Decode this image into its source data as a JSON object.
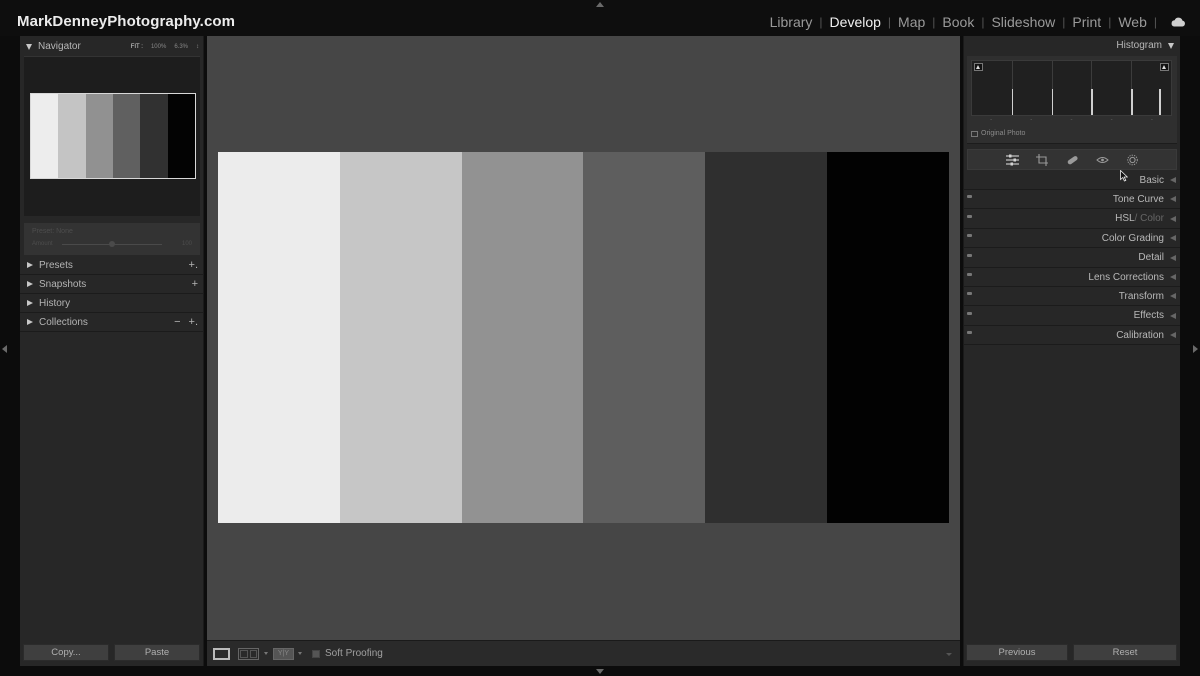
{
  "brand": "MarkDenneyPhotography.com",
  "modules": [
    {
      "label": "Library"
    },
    {
      "label": "Develop",
      "active": true
    },
    {
      "label": "Map"
    },
    {
      "label": "Book"
    },
    {
      "label": "Slideshow"
    },
    {
      "label": "Print"
    },
    {
      "label": "Web"
    }
  ],
  "navigator": {
    "title": "Navigator",
    "zoom": [
      "FIT :",
      "100%",
      "6.3%",
      "↕"
    ],
    "thumb_tones": [
      "#ededed",
      "#c4c4c4",
      "#919191",
      "#606060",
      "#313131",
      "#030303"
    ]
  },
  "preset_amount": {
    "title": "Preset: None",
    "label": "Amount",
    "value": "100"
  },
  "left_sections": [
    {
      "label": "Presets",
      "actions": [
        "+."
      ]
    },
    {
      "label": "Snapshots",
      "actions": [
        "+"
      ]
    },
    {
      "label": "History",
      "actions": []
    },
    {
      "label": "Collections",
      "actions": [
        "−",
        "+."
      ]
    }
  ],
  "left_buttons": {
    "copy": "Copy...",
    "paste": "Paste"
  },
  "photo": {
    "tones": [
      "#ececec",
      "#c6c6c6",
      "#929292",
      "#5e5e5e",
      "#2f2f2f",
      "#020202"
    ]
  },
  "toolbar": {
    "soft_proofing": "Soft Proofing",
    "ba_label": "Y|Y"
  },
  "histogram": {
    "title": "Histogram",
    "original_photo": "Original Photo"
  },
  "right_sections": [
    {
      "label": "Basic",
      "has_switch": false
    },
    {
      "label": "Tone Curve",
      "has_switch": true
    },
    {
      "label": "HSL",
      "sub": " / Color",
      "has_switch": true
    },
    {
      "label": "Color Grading",
      "has_switch": true
    },
    {
      "label": "Detail",
      "has_switch": true
    },
    {
      "label": "Lens Corrections",
      "has_switch": true
    },
    {
      "label": "Transform",
      "has_switch": true
    },
    {
      "label": "Effects",
      "has_switch": true
    },
    {
      "label": "Calibration",
      "has_switch": true
    }
  ],
  "right_buttons": {
    "previous": "Previous",
    "reset": "Reset"
  },
  "tool_icons": [
    "sliders-icon",
    "crop-icon",
    "healing-icon",
    "redeye-icon",
    "mask-icon"
  ]
}
